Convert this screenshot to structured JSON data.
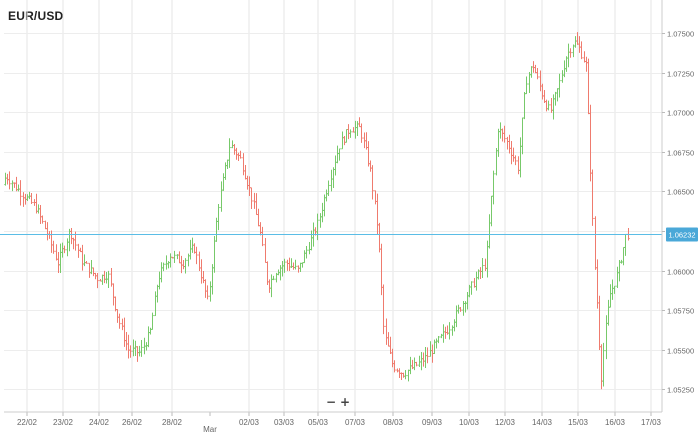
{
  "chart_data": {
    "type": "ohlc",
    "title": "EUR/USD",
    "xlabel": "",
    "ylabel": "",
    "ylim": [
      1.0515,
      1.0766
    ],
    "grid": true,
    "current_price": "1.06232",
    "x_tick_labels": [
      "22/02",
      "23/02",
      "24/02",
      "26/02",
      "28/02",
      "Mar",
      "02/03",
      "03/03",
      "05/03",
      "07/03",
      "08/03",
      "09/03",
      "10/03",
      "12/03",
      "14/03",
      "15/03",
      "16/03",
      "17/03"
    ],
    "y_tick_labels": [
      "1.07500",
      "1.07250",
      "1.07000",
      "1.06750",
      "1.06500",
      "1.06250",
      "1.06000",
      "1.05750",
      "1.05500",
      "1.05250"
    ],
    "y_tick_values": [
      1.075,
      1.0725,
      1.07,
      1.0675,
      1.065,
      1.0625,
      1.06,
      1.0575,
      1.055,
      1.0525
    ],
    "price_path": [
      [
        0,
        1.0645
      ],
      [
        8,
        1.066
      ],
      [
        22,
        1.065
      ],
      [
        38,
        1.064
      ],
      [
        50,
        1.0622
      ],
      [
        60,
        1.0605
      ],
      [
        72,
        1.0625
      ],
      [
        85,
        1.0605
      ],
      [
        100,
        1.0595
      ],
      [
        110,
        1.0598
      ],
      [
        120,
        1.057
      ],
      [
        130,
        1.055
      ],
      [
        142,
        1.0548
      ],
      [
        152,
        1.056
      ],
      [
        160,
        1.0595
      ],
      [
        172,
        1.061
      ],
      [
        185,
        1.0605
      ],
      [
        196,
        1.0615
      ],
      [
        210,
        1.058
      ],
      [
        220,
        1.064
      ],
      [
        232,
        1.068
      ],
      [
        243,
        1.067
      ],
      [
        252,
        1.065
      ],
      [
        262,
        1.0625
      ],
      [
        270,
        1.059
      ],
      [
        278,
        1.06
      ],
      [
        288,
        1.0605
      ],
      [
        300,
        1.06
      ],
      [
        310,
        1.0615
      ],
      [
        320,
        1.063
      ],
      [
        330,
        1.0655
      ],
      [
        342,
        1.068
      ],
      [
        352,
        1.069
      ],
      [
        362,
        1.069
      ],
      [
        372,
        1.0665
      ],
      [
        380,
        1.0625
      ],
      [
        386,
        1.056
      ],
      [
        395,
        1.054
      ],
      [
        405,
        1.0535
      ],
      [
        418,
        1.054
      ],
      [
        428,
        1.0545
      ],
      [
        440,
        1.0555
      ],
      [
        452,
        1.0565
      ],
      [
        465,
        1.058
      ],
      [
        478,
        1.0595
      ],
      [
        488,
        1.0605
      ],
      [
        494,
        1.065
      ],
      [
        500,
        1.069
      ],
      [
        510,
        1.068
      ],
      [
        520,
        1.0665
      ],
      [
        528,
        1.072
      ],
      [
        535,
        1.073
      ],
      [
        545,
        1.071
      ],
      [
        552,
        1.07
      ],
      [
        560,
        1.0715
      ],
      [
        568,
        1.0735
      ],
      [
        576,
        1.0745
      ],
      [
        582,
        1.074
      ],
      [
        588,
        1.073
      ],
      [
        592,
        1.067
      ],
      [
        596,
        1.061
      ],
      [
        600,
        1.057
      ],
      [
        603,
        1.053
      ],
      [
        607,
        1.056
      ],
      [
        612,
        1.0585
      ],
      [
        618,
        1.0595
      ],
      [
        624,
        1.061
      ],
      [
        628,
        1.0623
      ]
    ]
  }
}
